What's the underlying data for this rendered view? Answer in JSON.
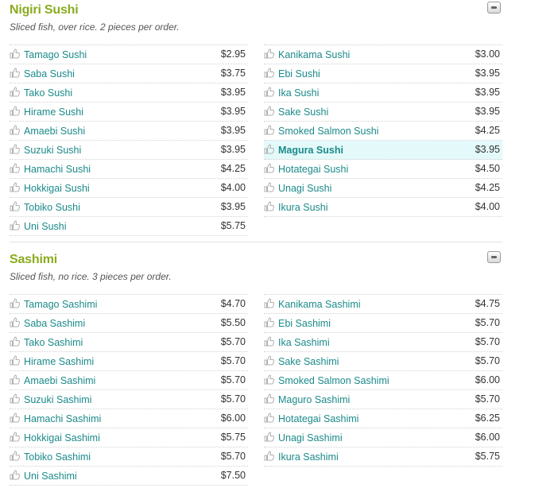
{
  "sections": [
    {
      "title": "Nigiri Sushi",
      "subtitle": "Sliced fish, over rice. 2 pieces per order.",
      "left": [
        {
          "name": "Tamago Sushi",
          "price": "$2.95"
        },
        {
          "name": "Saba Sushi",
          "price": "$3.75"
        },
        {
          "name": "Tako Sushi",
          "price": "$3.95"
        },
        {
          "name": "Hirame Sushi",
          "price": "$3.95"
        },
        {
          "name": "Amaebi Sushi",
          "price": "$3.95"
        },
        {
          "name": "Suzuki Sushi",
          "price": "$3.95"
        },
        {
          "name": "Hamachi Sushi",
          "price": "$4.25"
        },
        {
          "name": "Hokkigai Sushi",
          "price": "$4.00"
        },
        {
          "name": "Tobiko Sushi",
          "price": "$3.95"
        },
        {
          "name": "Uni Sushi",
          "price": "$5.75"
        }
      ],
      "right": [
        {
          "name": "Kanikama Sushi",
          "price": "$3.00"
        },
        {
          "name": "Ebi Sushi",
          "price": "$3.95"
        },
        {
          "name": "Ika Sushi",
          "price": "$3.95"
        },
        {
          "name": "Sake Sushi",
          "price": "$3.95"
        },
        {
          "name": "Smoked Salmon Sushi",
          "price": "$4.25"
        },
        {
          "name": "Magura Sushi",
          "price": "$3.95",
          "highlighted": true
        },
        {
          "name": "Hotategai Sushi",
          "price": "$4.50"
        },
        {
          "name": "Unagi Sushi",
          "price": "$4.25"
        },
        {
          "name": "Ikura Sushi",
          "price": "$4.00"
        }
      ]
    },
    {
      "title": "Sashimi",
      "subtitle": "Sliced fish, no rice. 3 pieces per order.",
      "left": [
        {
          "name": "Tamago Sashimi",
          "price": "$4.70"
        },
        {
          "name": "Saba Sashimi",
          "price": "$5.50"
        },
        {
          "name": "Tako Sashimi",
          "price": "$5.70"
        },
        {
          "name": "Hirame Sashimi",
          "price": "$5.70"
        },
        {
          "name": "Amaebi Sashimi",
          "price": "$5.70"
        },
        {
          "name": "Suzuki Sashimi",
          "price": "$5.70"
        },
        {
          "name": "Hamachi Sashimi",
          "price": "$6.00"
        },
        {
          "name": "Hokkigai Sashimi",
          "price": "$5.75"
        },
        {
          "name": "Tobiko Sashimi",
          "price": "$5.70"
        },
        {
          "name": "Uni Sashimi",
          "price": "$7.50"
        }
      ],
      "right": [
        {
          "name": "Kanikama Sashimi",
          "price": "$4.75"
        },
        {
          "name": "Ebi Sashimi",
          "price": "$5.70"
        },
        {
          "name": "Ika Sashimi",
          "price": "$5.70"
        },
        {
          "name": "Sake Sashimi",
          "price": "$5.70"
        },
        {
          "name": "Smoked Salmon Sashimi",
          "price": "$6.00"
        },
        {
          "name": "Maguro Sashimi",
          "price": "$5.70"
        },
        {
          "name": "Hotategai Sashimi",
          "price": "$6.25"
        },
        {
          "name": "Unagi Sashimi",
          "price": "$6.00"
        },
        {
          "name": "Ikura Sashimi",
          "price": "$5.75"
        }
      ]
    }
  ],
  "icons": {
    "item_icon": "thumbs-up-icon",
    "collapse_icon": "collapse-icon"
  },
  "colors": {
    "section_title": "#8aab1e",
    "item_link": "#1c8a8a",
    "highlight_bg": "#e4fafa"
  }
}
